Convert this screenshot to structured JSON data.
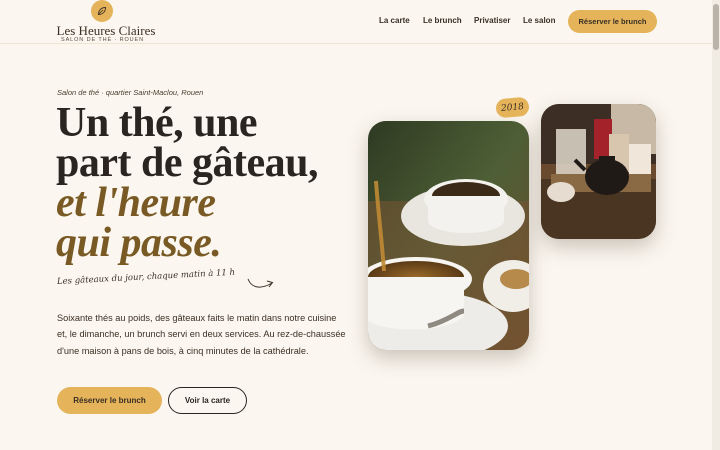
{
  "brand": {
    "name": "Les Heures Claires",
    "tagline": "SALON DE THÉ · ROUEN",
    "logo_icon": "leaf-icon"
  },
  "nav": {
    "items": [
      "La carte",
      "Le brunch",
      "Privatiser",
      "Le salon"
    ],
    "cta": "Réserver le brunch"
  },
  "hero": {
    "eyebrow": "Salon de thé · quartier Saint-Maclou, Rouen",
    "headline_line1": "Un thé, une",
    "headline_line2": "part de gâteau,",
    "headline_accent1": "et l'heure",
    "headline_accent2": "qui passe.",
    "hand_note": "Les gâteaux du jour, chaque matin à 11 h",
    "lead": "Soixante thés au poids, des gâteaux faits le matin dans notre cuisine et, le dimanche, un brunch servi en deux services. Au rez-de-chaussée d'une maison à pans de bois, à cinq minutes de la cathédrale.",
    "primary_button": "Réserver le brunch",
    "secondary_button": "Voir la carte",
    "year_badge": "2018"
  },
  "colors": {
    "background": "#fbf7f0",
    "accent": "#e4b35a",
    "text": "#2b2521",
    "accent_text": "#7a5a24"
  }
}
